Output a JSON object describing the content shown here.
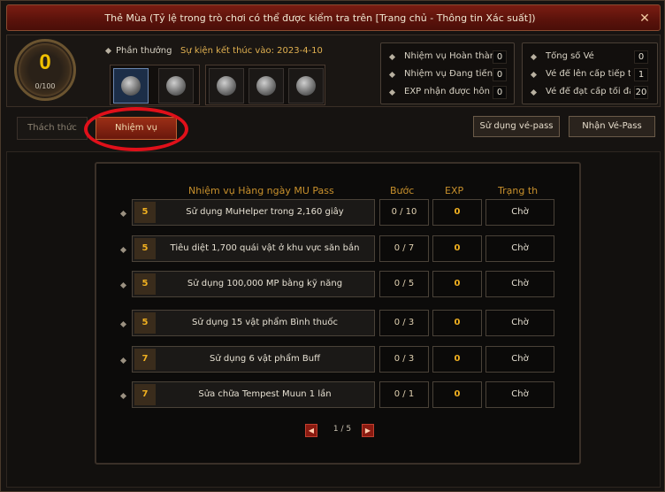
{
  "window": {
    "title": "Thẻ Mùa (Tỷ lệ trong trò chơi có thể được kiểm tra trên [Trang chủ - Thông tin Xác suất])",
    "close": "✕"
  },
  "level": {
    "value": "0",
    "exp": "0/100"
  },
  "rewards": {
    "label": "Phần thưởng",
    "event_end": "Sự kiện kết thúc vào: 2023-4-10"
  },
  "mission_stats": [
    {
      "label": "Nhiệm vụ Hoàn thàr",
      "value": "0"
    },
    {
      "label": "Nhiệm vụ Đang tiến",
      "value": "0"
    },
    {
      "label": "EXP nhận được hôn",
      "value": "0"
    }
  ],
  "pass_stats": [
    {
      "label": "Tổng số Vé",
      "value": "0"
    },
    {
      "label": "Vé để lên cấp tiếp tì",
      "value": "1"
    },
    {
      "label": "Vé để đạt cấp tối đa",
      "value": "20"
    }
  ],
  "tabs": {
    "challenge": "Thách thức",
    "missions": "Nhiệm vụ"
  },
  "buttons": {
    "use_pass": "Sử dụng vé-pass",
    "get_pass": "Nhận Vé-Pass"
  },
  "table": {
    "headers": {
      "mission": "Nhiệm vụ Hàng ngày MU Pass",
      "step": "Bước",
      "exp": "EXP",
      "status": "Trạng th"
    },
    "rows": [
      {
        "num": "5",
        "text": "Sử dụng MuHelper trong 2,160 giây",
        "step": "0 / 10",
        "exp": "0",
        "status": "Chờ"
      },
      {
        "num": "5",
        "text": "Tiêu diệt 1,700 quái vật ở khu vực săn bắn",
        "step": "0 / 7",
        "exp": "0",
        "status": "Chờ"
      },
      {
        "num": "5",
        "text": "Sử dụng 100,000 MP bằng kỹ năng",
        "step": "0 / 5",
        "exp": "0",
        "status": "Chờ"
      },
      {
        "num": "5",
        "text": "Sử dụng 15 vật phẩm Bình thuốc",
        "step": "0 / 3",
        "exp": "0",
        "status": "Chờ"
      },
      {
        "num": "7",
        "text": "Sử dụng 6 vật phẩm Buff",
        "step": "0 / 3",
        "exp": "0",
        "status": "Chờ"
      },
      {
        "num": "7",
        "text": "Sửa chữa Tempest Muun 1 lần",
        "step": "0 / 1",
        "exp": "0",
        "status": "Chờ"
      }
    ]
  },
  "pager": {
    "text": "1 / 5",
    "prev": "◀",
    "next": "▶"
  },
  "colors": {
    "accent_red": "#9b2e16",
    "highlight": "#e0101a",
    "gold": "#f0b020"
  }
}
